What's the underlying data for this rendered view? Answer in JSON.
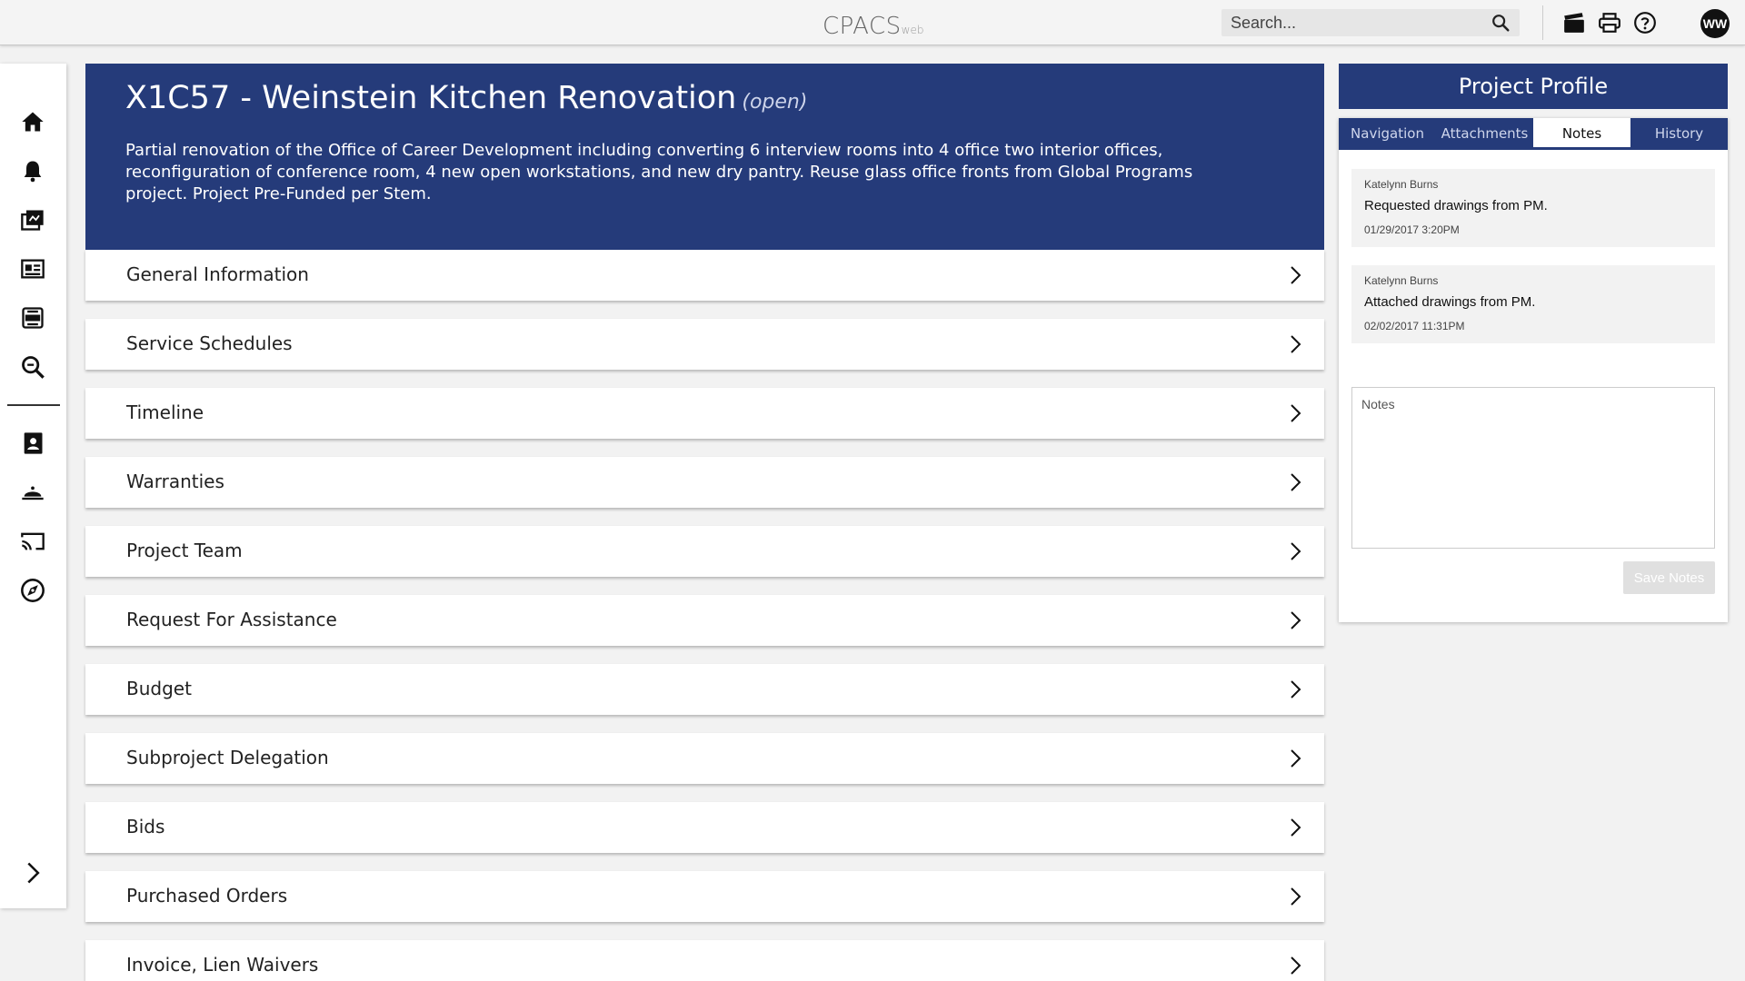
{
  "app": {
    "logo_main": "CPACS",
    "logo_sub": "web"
  },
  "search": {
    "placeholder": "Search..."
  },
  "user": {
    "initials": "WW"
  },
  "project": {
    "title": "X1C57 - Weinstein Kitchen Renovation",
    "status": "(open)",
    "description": "Partial renovation of the Office of Career Development including converting 6 interview rooms into 4 office two interior offices, reconfiguration of conference room, 4 new open workstations, and new dry pantry. Reuse glass office fronts from Global Programs project. Project Pre-Funded per Stem."
  },
  "sections": [
    "General Information",
    "Service Schedules",
    "Timeline",
    "Warranties",
    "Project Team",
    "Request For Assistance",
    "Budget",
    "Subproject Delegation",
    "Bids",
    "Purchased Orders",
    "Invoice, Lien Waivers"
  ],
  "profile": {
    "title": "Project Profile",
    "tabs": [
      "Navigation",
      "Attachments",
      "Notes",
      "History"
    ],
    "active_tab": "Notes",
    "notes": [
      {
        "author": "Katelynn Burns",
        "text": "Requested drawings from PM.",
        "date": "01/29/2017 3:20PM"
      },
      {
        "author": "Katelynn Burns",
        "text": "Attached drawings from PM.",
        "date": "02/02/2017 11:31PM"
      }
    ],
    "notes_placeholder": "Notes",
    "save_label": "Save Notes"
  },
  "colors": {
    "brand": "#253b7a",
    "background": "#f2f2f2"
  }
}
